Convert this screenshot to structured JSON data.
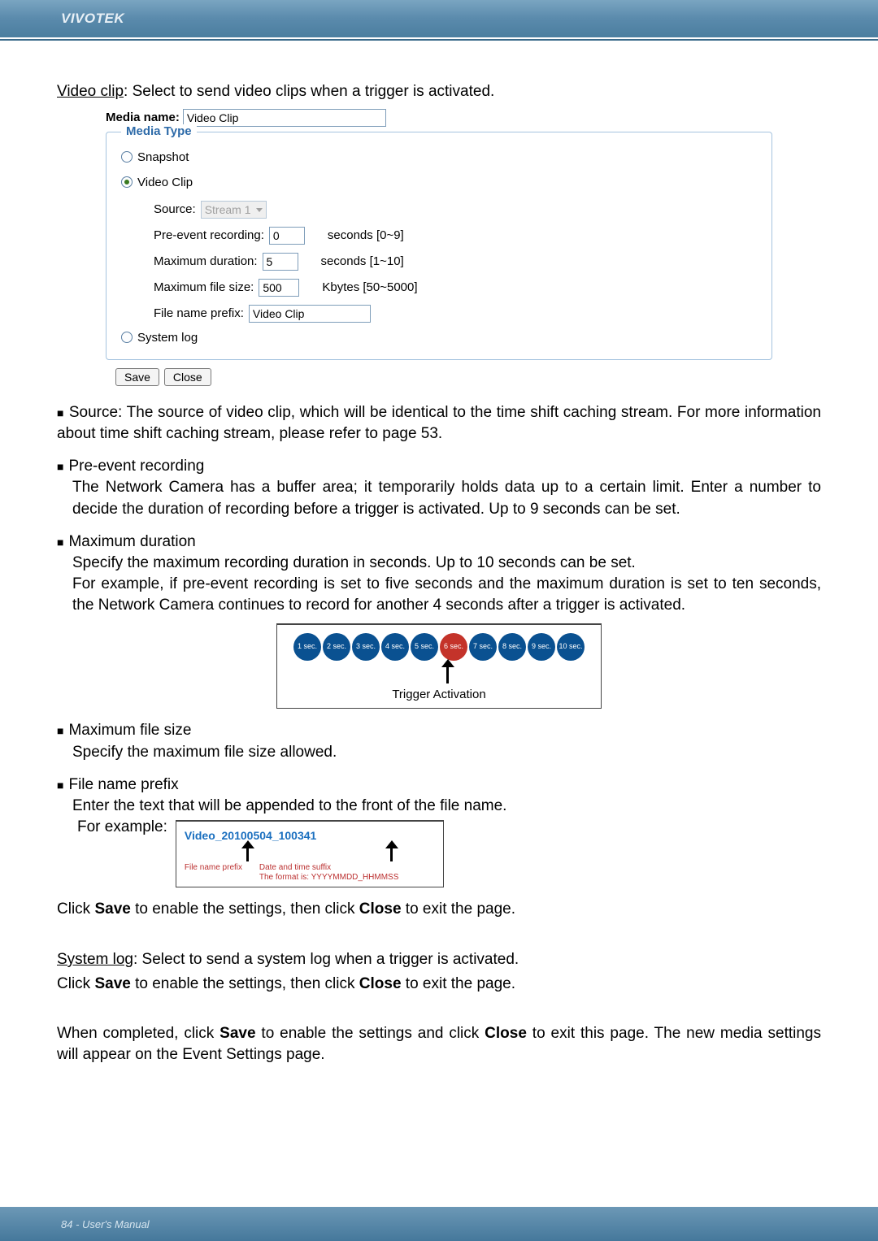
{
  "brand": "VIVOTEK",
  "intro": {
    "video_clip_label": "Video clip",
    "video_clip_text": ": Select to send video clips when a trigger is activated."
  },
  "media": {
    "media_name_label": "Media name:",
    "media_name_value": "Video Clip",
    "legend": "Media Type",
    "snapshot_label": "Snapshot",
    "videoclip_label": "Video Clip",
    "source_label": "Source:",
    "source_value": "Stream 1",
    "pre_event_label": "Pre-event recording:",
    "pre_event_value": "0",
    "pre_event_suffix": "seconds [0~9]",
    "max_dur_label": "Maximum duration:",
    "max_dur_value": "5",
    "max_dur_suffix": "seconds [1~10]",
    "max_size_label": "Maximum file size:",
    "max_size_value": "500",
    "max_size_suffix": "Kbytes [50~5000]",
    "prefix_label": "File name prefix:",
    "prefix_value": "Video Clip",
    "system_log_label": "System log",
    "save_btn": "Save",
    "close_btn": "Close"
  },
  "bullets": {
    "source_title": "Source: ",
    "source_body": "The source of video clip, which will be identical to the time shift caching stream. For more information about time shift caching stream, please refer to page 53.",
    "preevent_title": "Pre-event recording",
    "preevent_body": "The Network Camera has a buffer area; it temporarily holds data up to a certain limit. Enter a number to decide the duration of recording before a trigger is activated. Up to 9 seconds can be set.",
    "maxdur_title": "Maximum duration",
    "maxdur_body1": "Specify the maximum recording duration in seconds. Up to 10 seconds can be set.",
    "maxdur_body2": "For example, if pre-event recording is set to five seconds and the maximum duration is set to ten seconds, the Network Camera continues to record for another 4 seconds after a trigger is activated.",
    "maxsize_title": "Maximum file size",
    "maxsize_body": "Specify the maximum file size allowed.",
    "prefix_title": "File name prefix",
    "prefix_body": "Enter the text that will be appended to the front of the file name.",
    "for_example": "For example:"
  },
  "timeline": {
    "labels": [
      "1 sec.",
      "2 sec.",
      "3 sec.",
      "4 sec.",
      "5 sec.",
      "6 sec.",
      "7 sec.",
      "8 sec.",
      "9 sec.",
      "10 sec."
    ],
    "caption": "Trigger Activation"
  },
  "example": {
    "filename": "Video_20100504_100341",
    "prefix_label": "File name prefix",
    "suffix_label1": "Date and time suffix",
    "suffix_label2": "The format is: YYYYMMDD_HHMMSS"
  },
  "tail": {
    "p1a": "Click ",
    "p1_save": "Save",
    "p1b": " to enable the settings, then click ",
    "p1_close": "Close",
    "p1c": " to exit the page.",
    "syslog_label": "System log",
    "syslog_text": ": Select to send a system log when a trigger is activated.",
    "p3a": "When completed, click ",
    "p3b": " to enable the settings and click ",
    "p3c": " to exit this page. The new media settings will appear on the Event Settings page."
  },
  "footer": "84 - User's Manual"
}
